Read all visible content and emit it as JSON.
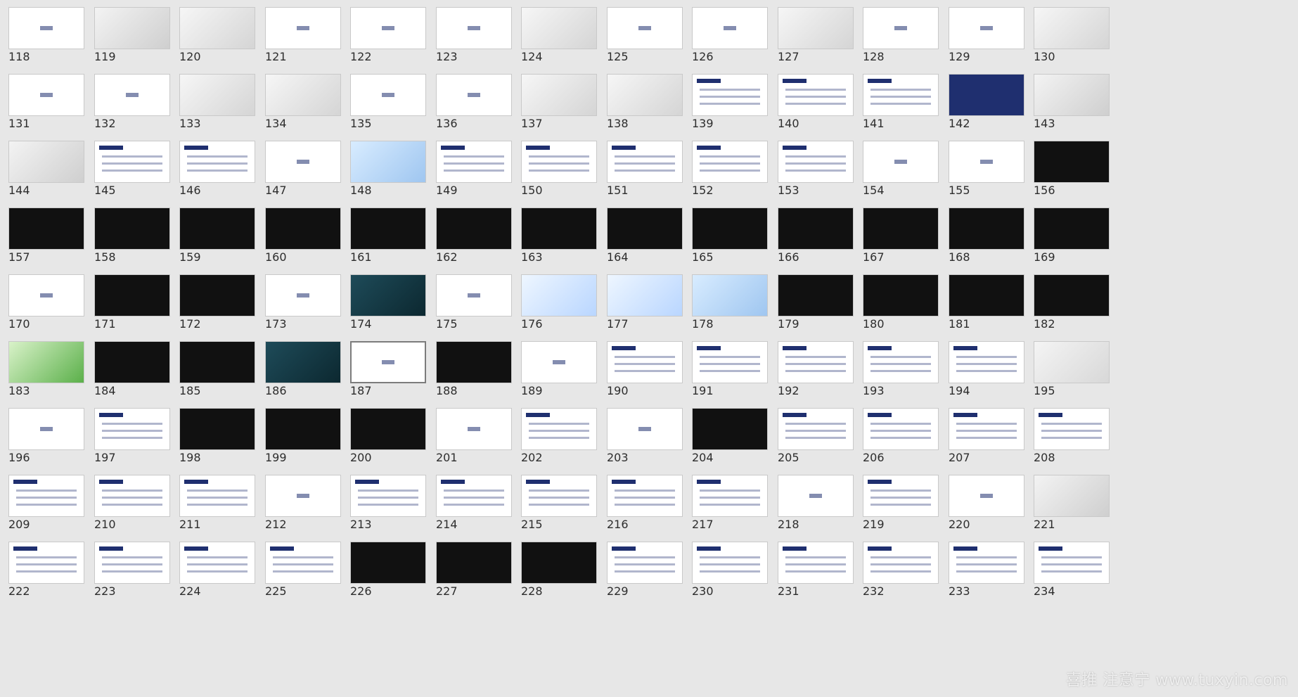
{
  "watermark": "喜推 注意宁 www.tuxyin.com",
  "slides": [
    {
      "num": "118",
      "style": "white"
    },
    {
      "num": "119",
      "style": "photo"
    },
    {
      "num": "120",
      "style": "bottle"
    },
    {
      "num": "121",
      "style": "white"
    },
    {
      "num": "122",
      "style": "white"
    },
    {
      "num": "123",
      "style": "white"
    },
    {
      "num": "124",
      "style": "bottle"
    },
    {
      "num": "125",
      "style": "white"
    },
    {
      "num": "126",
      "style": "white"
    },
    {
      "num": "127",
      "style": "bottle"
    },
    {
      "num": "128",
      "style": "white"
    },
    {
      "num": "129",
      "style": "white"
    },
    {
      "num": "130",
      "style": "bottle"
    },
    {
      "num": "131",
      "style": "white"
    },
    {
      "num": "132",
      "style": "white"
    },
    {
      "num": "133",
      "style": "bottle"
    },
    {
      "num": "134",
      "style": "bottle"
    },
    {
      "num": "135",
      "style": "white"
    },
    {
      "num": "136",
      "style": "white"
    },
    {
      "num": "137",
      "style": "bottle"
    },
    {
      "num": "138",
      "style": "bottle"
    },
    {
      "num": "139",
      "style": "doc"
    },
    {
      "num": "140",
      "style": "doc"
    },
    {
      "num": "141",
      "style": "doc"
    },
    {
      "num": "142",
      "style": "navy"
    },
    {
      "num": "143",
      "style": "photo"
    },
    {
      "num": "144",
      "style": "photo"
    },
    {
      "num": "145",
      "style": "doc"
    },
    {
      "num": "146",
      "style": "doc"
    },
    {
      "num": "147",
      "style": "white"
    },
    {
      "num": "148",
      "style": "sky"
    },
    {
      "num": "149",
      "style": "doc"
    },
    {
      "num": "150",
      "style": "doc"
    },
    {
      "num": "151",
      "style": "doc"
    },
    {
      "num": "152",
      "style": "doc"
    },
    {
      "num": "153",
      "style": "doc"
    },
    {
      "num": "154",
      "style": "white"
    },
    {
      "num": "155",
      "style": "white"
    },
    {
      "num": "156",
      "style": "black"
    },
    {
      "num": "157",
      "style": "black"
    },
    {
      "num": "158",
      "style": "black"
    },
    {
      "num": "159",
      "style": "black"
    },
    {
      "num": "160",
      "style": "black"
    },
    {
      "num": "161",
      "style": "black"
    },
    {
      "num": "162",
      "style": "black"
    },
    {
      "num": "163",
      "style": "black"
    },
    {
      "num": "164",
      "style": "black"
    },
    {
      "num": "165",
      "style": "black"
    },
    {
      "num": "166",
      "style": "black"
    },
    {
      "num": "167",
      "style": "black"
    },
    {
      "num": "168",
      "style": "black"
    },
    {
      "num": "169",
      "style": "black"
    },
    {
      "num": "170",
      "style": "white"
    },
    {
      "num": "171",
      "style": "black"
    },
    {
      "num": "172",
      "style": "black"
    },
    {
      "num": "173",
      "style": "white"
    },
    {
      "num": "174",
      "style": "ocean"
    },
    {
      "num": "175",
      "style": "white"
    },
    {
      "num": "176",
      "style": "snow"
    },
    {
      "num": "177",
      "style": "snow"
    },
    {
      "num": "178",
      "style": "sky"
    },
    {
      "num": "179",
      "style": "black"
    },
    {
      "num": "180",
      "style": "black"
    },
    {
      "num": "181",
      "style": "black"
    },
    {
      "num": "182",
      "style": "black"
    },
    {
      "num": "183",
      "style": "green"
    },
    {
      "num": "184",
      "style": "black"
    },
    {
      "num": "185",
      "style": "black"
    },
    {
      "num": "186",
      "style": "ocean"
    },
    {
      "num": "187",
      "style": "white",
      "selected": true
    },
    {
      "num": "188",
      "style": "black"
    },
    {
      "num": "189",
      "style": "white"
    },
    {
      "num": "190",
      "style": "doc"
    },
    {
      "num": "191",
      "style": "doc"
    },
    {
      "num": "192",
      "style": "doc"
    },
    {
      "num": "193",
      "style": "doc"
    },
    {
      "num": "194",
      "style": "doc"
    },
    {
      "num": "195",
      "style": "grey"
    },
    {
      "num": "196",
      "style": "white"
    },
    {
      "num": "197",
      "style": "doc"
    },
    {
      "num": "198",
      "style": "black"
    },
    {
      "num": "199",
      "style": "black"
    },
    {
      "num": "200",
      "style": "black"
    },
    {
      "num": "201",
      "style": "white"
    },
    {
      "num": "202",
      "style": "doc"
    },
    {
      "num": "203",
      "style": "white"
    },
    {
      "num": "204",
      "style": "black"
    },
    {
      "num": "205",
      "style": "doc"
    },
    {
      "num": "206",
      "style": "doc"
    },
    {
      "num": "207",
      "style": "doc"
    },
    {
      "num": "208",
      "style": "doc"
    },
    {
      "num": "209",
      "style": "doc"
    },
    {
      "num": "210",
      "style": "doc"
    },
    {
      "num": "211",
      "style": "doc"
    },
    {
      "num": "212",
      "style": "white"
    },
    {
      "num": "213",
      "style": "doc"
    },
    {
      "num": "214",
      "style": "doc"
    },
    {
      "num": "215",
      "style": "doc"
    },
    {
      "num": "216",
      "style": "doc"
    },
    {
      "num": "217",
      "style": "doc"
    },
    {
      "num": "218",
      "style": "white"
    },
    {
      "num": "219",
      "style": "doc"
    },
    {
      "num": "220",
      "style": "white"
    },
    {
      "num": "221",
      "style": "photo"
    },
    {
      "num": "222",
      "style": "doc"
    },
    {
      "num": "223",
      "style": "doc"
    },
    {
      "num": "224",
      "style": "doc"
    },
    {
      "num": "225",
      "style": "doc"
    },
    {
      "num": "226",
      "style": "black"
    },
    {
      "num": "227",
      "style": "black"
    },
    {
      "num": "228",
      "style": "black"
    },
    {
      "num": "229",
      "style": "doc"
    },
    {
      "num": "230",
      "style": "doc"
    },
    {
      "num": "231",
      "style": "doc"
    },
    {
      "num": "232",
      "style": "doc"
    },
    {
      "num": "233",
      "style": "doc"
    },
    {
      "num": "234",
      "style": "doc"
    }
  ]
}
